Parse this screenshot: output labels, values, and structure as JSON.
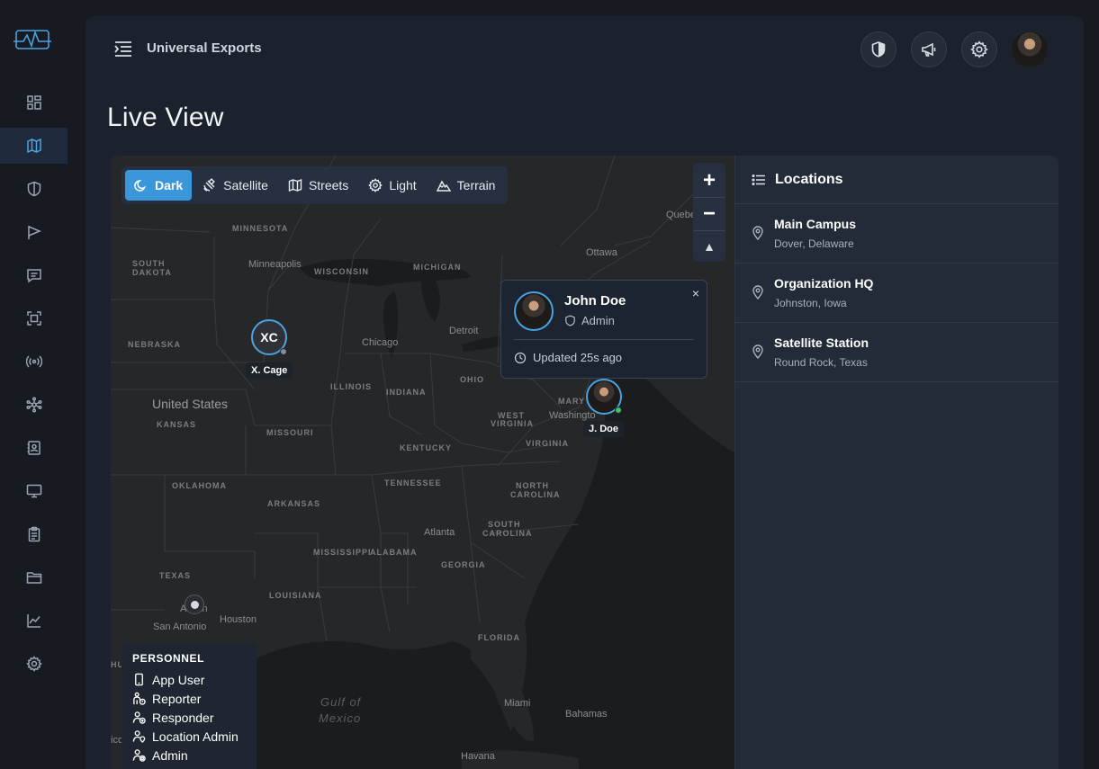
{
  "app": {
    "org_name": "Universal Exports",
    "page_title": "Live View"
  },
  "nav": [
    "dashboard-icon",
    "map-icon",
    "shield-icon",
    "flag-icon",
    "chat-icon",
    "scan-icon",
    "broadcast-icon",
    "network-icon",
    "contacts-icon",
    "monitor-icon",
    "clipboard-icon",
    "folder-icon",
    "chart-icon",
    "gear-icon"
  ],
  "map": {
    "styles": [
      "Dark",
      "Satellite",
      "Streets",
      "Light",
      "Terrain"
    ],
    "active_style": "Dark",
    "labels": {
      "quebec": "Quebe",
      "minnesota": "MINNESOTA",
      "ottawa": "Ottawa",
      "south_dakota_1": "SOUTH",
      "south_dakota_2": "DAKOTA",
      "minneapolis": "Minneapolis",
      "wisconsin": "WISCONSIN",
      "michigan": "MICHIGAN",
      "nebraska": "NEBRASKA",
      "chicago": "Chicago",
      "detroit": "Detroit",
      "illinois": "ILLINOIS",
      "indiana": "INDIANA",
      "ohio": "OHIO",
      "united_states": "United States",
      "kansas": "KANSAS",
      "missouri": "MISSOURI",
      "west_virginia_1": "WEST",
      "west_virginia_2": "VIRGINIA",
      "washington": "Washingto",
      "maryland": "MARY",
      "virginia": "VIRGINIA",
      "kentucky": "KENTUCKY",
      "oklahoma": "OKLAHOMA",
      "tennessee": "TENNESSEE",
      "north_carolina_1": "NORTH",
      "north_carolina_2": "CAROLINA",
      "arkansas": "ARKANSAS",
      "south_carolina_1": "SOUTH",
      "south_carolina_2": "CAROLINA",
      "atlanta": "Atlanta",
      "mississippi": "MISSISSIPPI",
      "alabama": "ALABAMA",
      "georgia": "GEORGIA",
      "texas": "TEXAS",
      "louisiana": "LOUISIANA",
      "austin": "Austin",
      "san_antonio": "San Antonio",
      "houston": "Houston",
      "florida": "FLORIDA",
      "gulf_1": "Gulf of",
      "gulf_2": "Mexico",
      "miami": "Miami",
      "bahamas": "Bahamas",
      "havana": "Havana",
      "hu": "HU",
      "ico": "ico"
    },
    "markers": {
      "xcage": {
        "initials": "XC",
        "label": "X. Cage"
      },
      "jdoe": {
        "label": "J. Doe"
      }
    },
    "popup": {
      "name": "John Doe",
      "role": "Admin",
      "updated": "Updated 25s ago",
      "close": "×"
    },
    "zoom": {
      "in": "+",
      "out": "−",
      "compass": "▲"
    },
    "legend": {
      "title": "PERSONNEL",
      "items": [
        "App User",
        "Reporter",
        "Responder",
        "Location Admin",
        "Admin"
      ]
    }
  },
  "locations": {
    "title": "Locations",
    "items": [
      {
        "name": "Main Campus",
        "address": "Dover, Delaware"
      },
      {
        "name": "Organization HQ",
        "address": "Johnston, Iowa"
      },
      {
        "name": "Satellite Station",
        "address": "Round Rock, Texas"
      }
    ]
  },
  "colors": {
    "accent": "#3b97d9",
    "online": "#3fbf6a",
    "offline": "#8a8d93"
  }
}
